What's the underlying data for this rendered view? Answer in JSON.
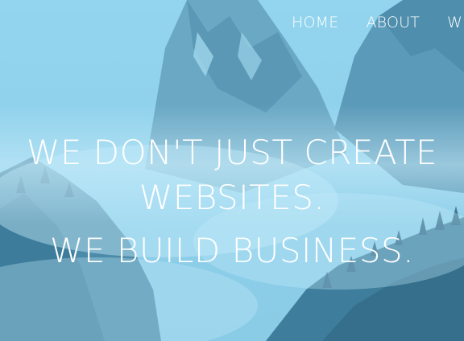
{
  "nav": {
    "items": [
      {
        "label": "HOME"
      },
      {
        "label": "ABOUT"
      },
      {
        "label": "W"
      }
    ]
  },
  "hero": {
    "line1": "WE DON'T JUST CREATE",
    "line2": "WEBSITES.",
    "line3": "WE BUILD BUSINESS."
  },
  "colors": {
    "overlay": "#8fd2ec",
    "mountain": "#5a9ab8",
    "forest": "#3f7f9d",
    "text": "#ffffff"
  },
  "icons": {
    "background": "misty-mountains-image"
  }
}
